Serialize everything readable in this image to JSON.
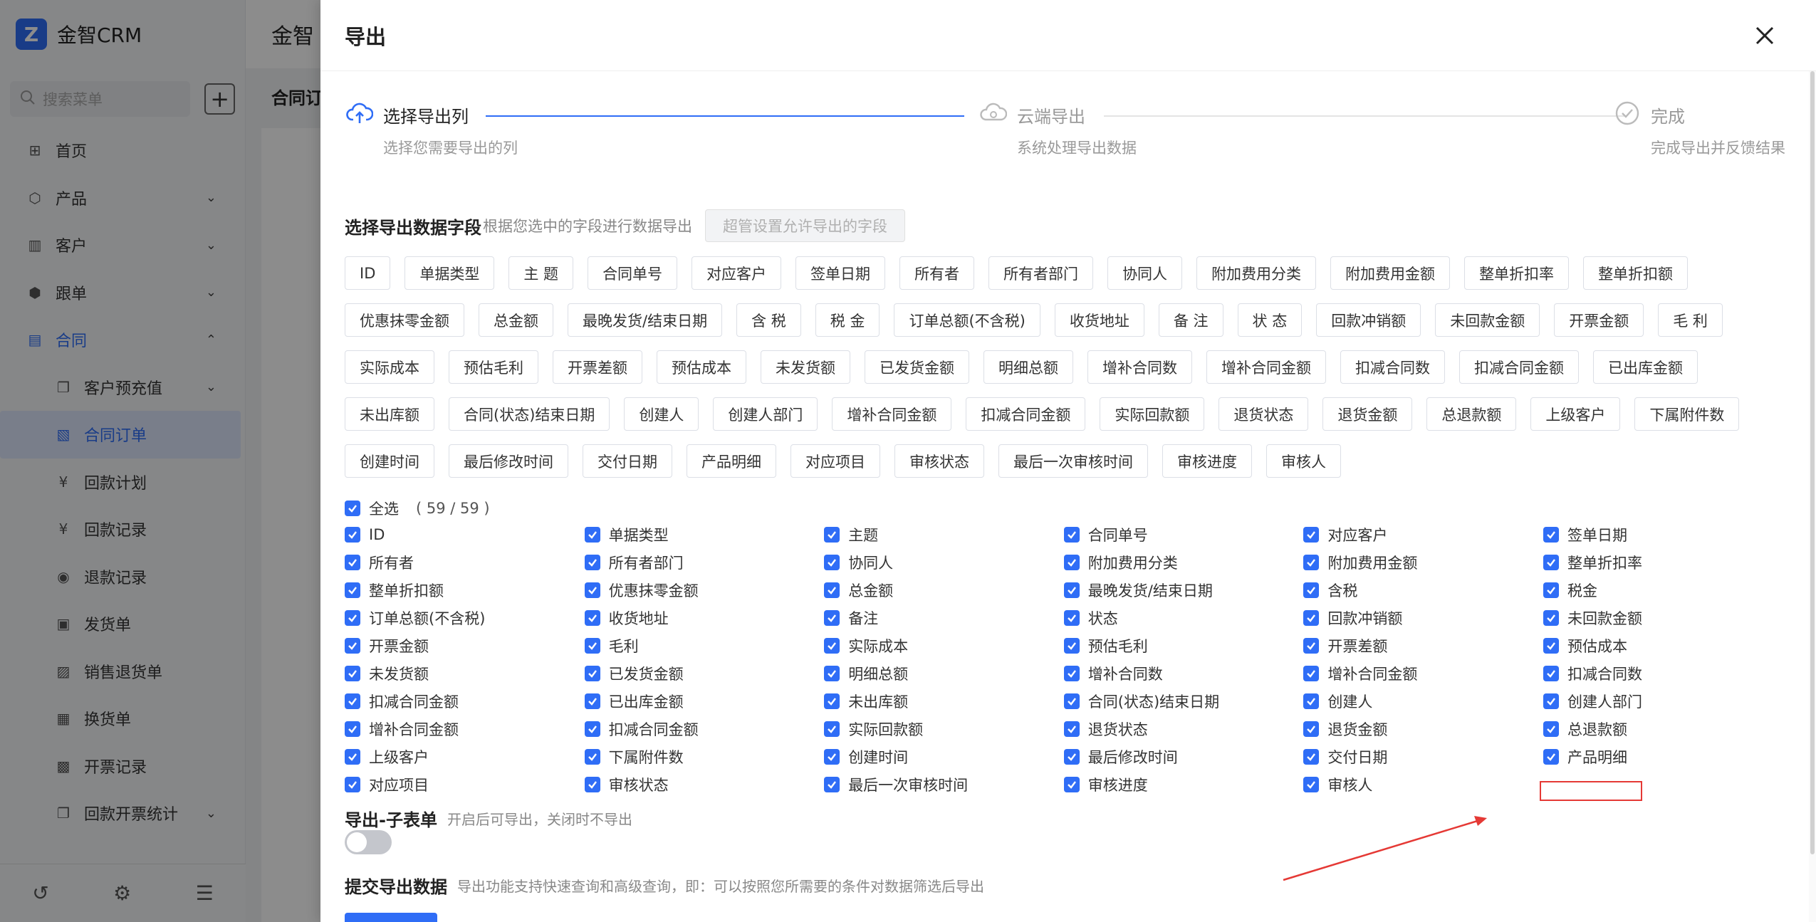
{
  "app": {
    "logo_text": "金智CRM",
    "search_placeholder": "搜索菜单",
    "header_title": "金智",
    "sub_title": "合同订",
    "menu": [
      {
        "label": "首页",
        "icon": "home-icon"
      },
      {
        "label": "产品",
        "icon": "cube-icon"
      },
      {
        "label": "客户",
        "icon": "chart-icon"
      },
      {
        "label": "跟单",
        "icon": "box-icon"
      },
      {
        "label": "合同",
        "icon": "contract-icon"
      },
      {
        "label": "客户预充值",
        "icon": "copy-icon"
      },
      {
        "label": "合同订单",
        "icon": "doc-icon"
      },
      {
        "label": "回款计划",
        "icon": "yen-icon"
      },
      {
        "label": "回款记录",
        "icon": "yen-icon"
      },
      {
        "label": "退款记录",
        "icon": "refund-icon"
      },
      {
        "label": "发货单",
        "icon": "truck-icon"
      },
      {
        "label": "销售退货单",
        "icon": "return-icon"
      },
      {
        "label": "换货单",
        "icon": "exchange-icon"
      },
      {
        "label": "开票记录",
        "icon": "invoice-icon"
      },
      {
        "label": "回款开票统计",
        "icon": "copy-icon"
      }
    ]
  },
  "drawer": {
    "title": "导出",
    "steps": [
      {
        "title": "选择导出列",
        "desc": "选择您需要导出的列"
      },
      {
        "title": "云端导出",
        "desc": "系统处理导出数据"
      },
      {
        "title": "完成",
        "desc": "完成导出并反馈结果"
      }
    ],
    "section_title": "选择导出数据字段",
    "section_desc": "根据您选中的字段进行数据导出",
    "admin_button": "超管设置允许导出的字段",
    "tags": [
      "ID",
      "单据类型",
      "主 题",
      "合同单号",
      "对应客户",
      "签单日期",
      "所有者",
      "所有者部门",
      "协同人",
      "附加费用分类",
      "附加费用金额",
      "整单折扣率",
      "整单折扣额",
      "优惠抹零金额",
      "总金额",
      "最晚发货/结束日期",
      "含 税",
      "税 金",
      "订单总额(不含税)",
      "收货地址",
      "备 注",
      "状 态",
      "回款冲销额",
      "未回款金额",
      "开票金额",
      "毛 利",
      "实际成本",
      "预估毛利",
      "开票差额",
      "预估成本",
      "未发货额",
      "已发货金额",
      "明细总额",
      "增补合同数",
      "增补合同金额",
      "扣减合同数",
      "扣减合同金额",
      "已出库金额",
      "未出库额",
      "合同(状态)结束日期",
      "创建人",
      "创建人部门",
      "增补合同金额",
      "扣减合同金额",
      "实际回款额",
      "退货状态",
      "退货金额",
      "总退款额",
      "上级客户",
      "下属附件数",
      "创建时间",
      "最后修改时间",
      "交付日期",
      "产品明细",
      "对应项目",
      "审核状态",
      "最后一次审核时间",
      "审核进度",
      "审核人"
    ],
    "select_all_label": "全选",
    "select_all_count": "( 59 / 59 )",
    "checkboxes": [
      "ID",
      "单据类型",
      "主题",
      "合同单号",
      "对应客户",
      "签单日期",
      "所有者",
      "所有者部门",
      "协同人",
      "附加费用分类",
      "附加费用金额",
      "整单折扣率",
      "整单折扣额",
      "优惠抹零金额",
      "总金额",
      "最晚发货/结束日期",
      "含税",
      "税金",
      "订单总额(不含税)",
      "收货地址",
      "备注",
      "状态",
      "回款冲销额",
      "未回款金额",
      "开票金额",
      "毛利",
      "实际成本",
      "预估毛利",
      "开票差额",
      "预估成本",
      "未发货额",
      "已发货金额",
      "明细总额",
      "增补合同数",
      "增补合同金额",
      "扣减合同数",
      "扣减合同金额",
      "已出库金额",
      "未出库额",
      "合同(状态)结束日期",
      "创建人",
      "创建人部门",
      "增补合同金额",
      "扣减合同金额",
      "实际回款额",
      "退货状态",
      "退货金额",
      "总退款额",
      "上级客户",
      "下属附件数",
      "创建时间",
      "最后修改时间",
      "交付日期",
      "产品明细",
      "对应项目",
      "审核状态",
      "最后一次审核时间",
      "审核进度",
      "审核人"
    ],
    "sub_table_title": "导出-子表单",
    "sub_table_desc": "开启后可导出，关闭时不导出",
    "sub_table_enabled": false,
    "submit_title": "提交导出数据",
    "submit_desc": "导出功能支持快速查询和高级查询，即：可以按照您所需要的条件对数据筛选后导出"
  },
  "colors": {
    "accent": "#2f6df6",
    "annotation": "#e53935"
  }
}
